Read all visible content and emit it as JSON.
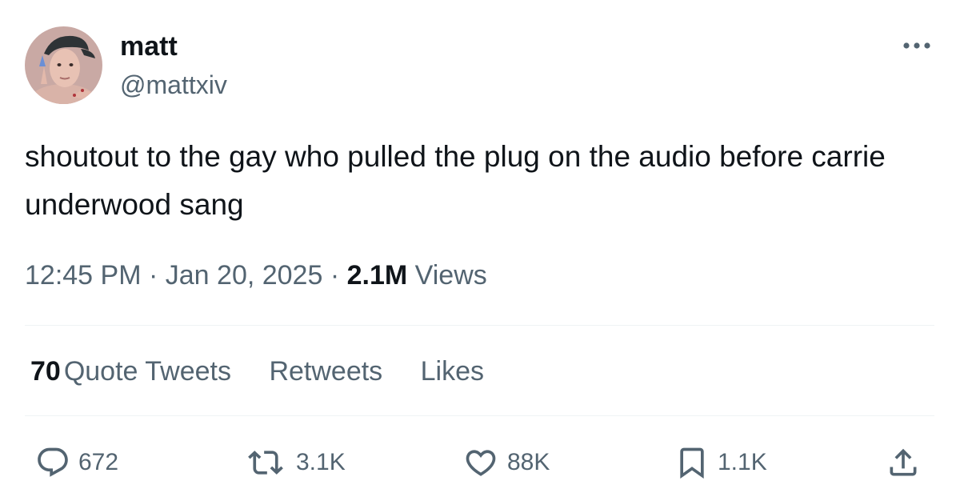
{
  "author": {
    "display_name": "matt",
    "handle": "@mattxiv"
  },
  "tweet": {
    "text": "shoutout to the gay who pulled the plug on the audio before carrie underwood sang"
  },
  "meta": {
    "time": "12:45 PM",
    "separator": "·",
    "date": "Jan 20, 2025",
    "views_count": "2.1M",
    "views_label": "Views"
  },
  "stats": {
    "quote_tweets_count": "70",
    "quote_tweets_label": "Quote Tweets",
    "retweets_label": "Retweets",
    "likes_label": "Likes"
  },
  "actions": {
    "replies": "672",
    "retweets": "3.1K",
    "likes": "88K",
    "bookmarks": "1.1K"
  },
  "icons": {
    "reply": "reply-icon",
    "retweet": "retweet-icon",
    "like": "heart-icon",
    "bookmark": "bookmark-icon",
    "share": "share-icon",
    "more": "more-icon"
  },
  "colors": {
    "text_primary": "#0f1419",
    "text_secondary": "#536471",
    "divider": "#eff3f4"
  }
}
